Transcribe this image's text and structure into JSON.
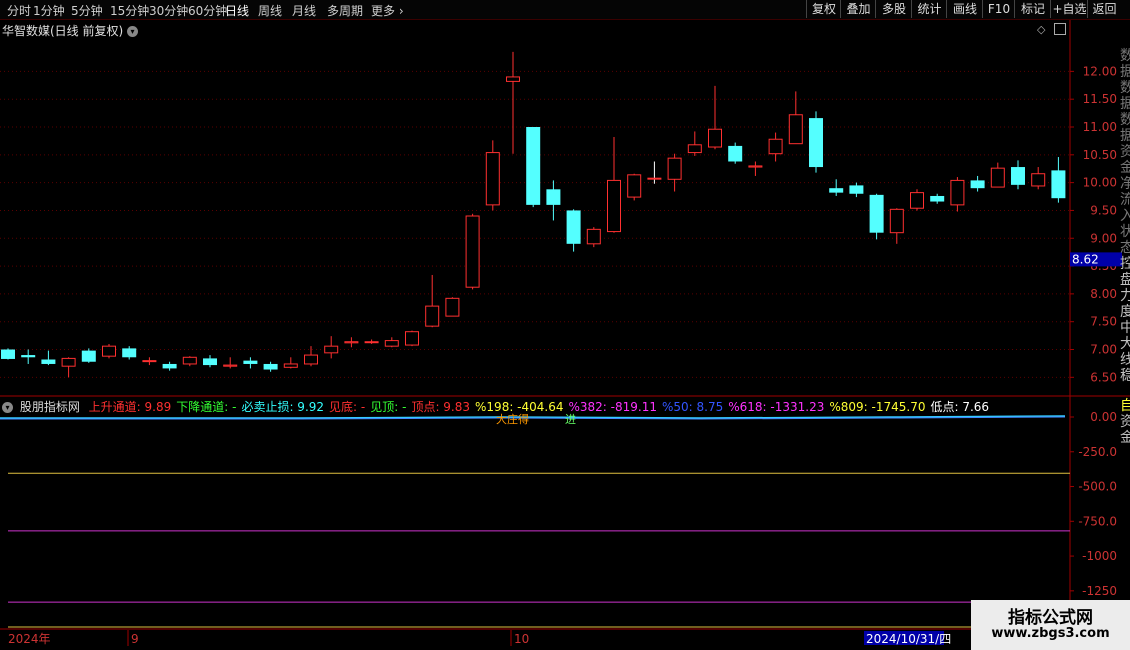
{
  "toolbar": {
    "periods": [
      "分时",
      "1分钟",
      "5分钟",
      "15分钟",
      "30分钟",
      "60分钟",
      "日线",
      "周线",
      "月线",
      "多周期",
      "更多"
    ],
    "active_period": "日线",
    "right_buttons": [
      "复权",
      "叠加",
      "多股",
      "统计",
      "画线",
      "F10",
      "标记",
      "+自选",
      "返回"
    ]
  },
  "chart_title": "华智数媒(日线 前复权)",
  "price_axis": [
    "12.00",
    "11.50",
    "11.00",
    "10.50",
    "10.00",
    "9.50",
    "9.00",
    "8.50",
    "8.00",
    "7.50",
    "7.00",
    "6.50"
  ],
  "current_price_tag": "8.62",
  "indicator": {
    "name": "股朋指标网",
    "items": [
      {
        "label": "上升通道: 9.89",
        "color": "#ff3030"
      },
      {
        "label": "下降通道: -",
        "color": "#33ff33"
      },
      {
        "label": "必卖止损: 9.92",
        "color": "#33ffff"
      },
      {
        "label": "见底: -",
        "color": "#ff3030"
      },
      {
        "label": "见顶: -",
        "color": "#33ff33"
      },
      {
        "label": "顶点: 9.83",
        "color": "#ff3030"
      },
      {
        "label": "%198: -404.64",
        "color": "#ffff33"
      },
      {
        "label": "%382: -819.11",
        "color": "#ff33ff"
      },
      {
        "label": "%50: 8.75",
        "color": "#3355ff"
      },
      {
        "label": "%618: -1331.23",
        "color": "#ff33ff"
      },
      {
        "label": "%809: -1745.70",
        "color": "#ffff33"
      },
      {
        "label": "低点: 7.66",
        "color": "#ffffff"
      }
    ],
    "annotations": [
      "大庄得",
      "进"
    ]
  },
  "indicator_axis": [
    "0.00",
    "-250.0",
    "-500.0",
    "-750.0",
    "-1000",
    "-1250"
  ],
  "date_axis": {
    "year_label": "2024年",
    "month_9": "9",
    "month_10": "10",
    "cursor_date": "2024/10/31/四"
  },
  "right_panel_chars": [
    "数",
    "据",
    "数",
    "据",
    "数",
    "据",
    "资",
    "金",
    "净",
    "流",
    "入",
    "状",
    "态",
    "控",
    "盘",
    "力",
    "度",
    "中",
    "大",
    "线",
    "稳"
  ],
  "right_panel_chars_lower": [
    "自",
    "资",
    "金"
  ],
  "watermark": {
    "line1": "指标公式网",
    "line2": "www.zbgs3.com"
  },
  "chart_data": {
    "type": "candlestick",
    "y_range": [
      6.2,
      12.6
    ],
    "up_color": "#ff3030",
    "down_color": "#54ffff",
    "candles": [
      [
        7.0,
        6.83,
        7.02,
        6.82
      ],
      [
        6.9,
        6.86,
        7.0,
        6.74
      ],
      [
        6.82,
        6.74,
        6.98,
        6.72
      ],
      [
        6.7,
        6.84,
        6.86,
        6.5
      ],
      [
        6.98,
        6.78,
        7.02,
        6.76
      ],
      [
        6.88,
        7.06,
        7.1,
        6.84
      ],
      [
        7.02,
        6.86,
        7.06,
        6.82
      ],
      [
        6.8,
        6.8,
        6.86,
        6.72
      ],
      [
        6.74,
        6.66,
        6.78,
        6.62
      ],
      [
        6.74,
        6.86,
        6.88,
        6.7
      ],
      [
        6.84,
        6.72,
        6.9,
        6.68
      ],
      [
        6.7,
        6.72,
        6.86,
        6.66
      ],
      [
        6.8,
        6.74,
        6.86,
        6.66
      ],
      [
        6.74,
        6.64,
        6.78,
        6.6
      ],
      [
        6.68,
        6.74,
        6.86,
        6.66
      ],
      [
        6.74,
        6.9,
        7.06,
        6.7
      ],
      [
        6.94,
        7.06,
        7.24,
        6.84
      ],
      [
        7.12,
        7.14,
        7.22,
        7.04
      ],
      [
        7.14,
        7.14,
        7.18,
        7.1
      ],
      [
        7.06,
        7.16,
        7.22,
        7.04
      ],
      [
        7.08,
        7.32,
        7.34,
        7.06
      ],
      [
        7.42,
        7.78,
        8.34,
        7.4
      ],
      [
        7.6,
        7.92,
        7.94,
        7.6
      ],
      [
        8.12,
        9.4,
        9.44,
        8.08
      ],
      [
        9.6,
        10.54,
        10.76,
        9.5
      ],
      [
        11.82,
        11.9,
        12.35,
        10.52
      ],
      [
        11.0,
        9.6,
        11.0,
        9.56
      ],
      [
        9.88,
        9.6,
        10.04,
        9.32
      ],
      [
        9.5,
        8.9,
        9.52,
        8.76
      ],
      [
        8.9,
        9.16,
        9.2,
        8.84
      ],
      [
        9.12,
        10.04,
        10.82,
        9.1
      ],
      [
        9.74,
        10.14,
        10.16,
        9.68
      ],
      [
        10.08,
        10.08,
        10.38,
        9.98
      ],
      [
        10.06,
        10.44,
        10.52,
        9.84
      ],
      [
        10.54,
        10.68,
        10.92,
        10.48
      ],
      [
        10.64,
        10.96,
        11.74,
        10.6
      ],
      [
        10.66,
        10.38,
        10.72,
        10.34
      ],
      [
        10.28,
        10.3,
        10.38,
        10.12
      ],
      [
        10.52,
        10.78,
        10.9,
        10.38
      ],
      [
        10.7,
        11.22,
        11.64,
        10.7
      ],
      [
        11.16,
        10.28,
        11.28,
        10.18
      ],
      [
        9.9,
        9.82,
        10.06,
        9.76
      ],
      [
        9.95,
        9.8,
        10.0,
        9.74
      ],
      [
        9.78,
        9.1,
        9.8,
        8.98
      ],
      [
        9.1,
        9.52,
        9.54,
        8.9
      ],
      [
        9.54,
        9.82,
        9.88,
        9.5
      ],
      [
        9.76,
        9.66,
        9.8,
        9.62
      ],
      [
        9.6,
        10.04,
        10.1,
        9.48
      ],
      [
        10.04,
        9.9,
        10.12,
        9.84
      ],
      [
        9.92,
        10.26,
        10.36,
        9.92
      ],
      [
        10.28,
        9.96,
        10.4,
        9.88
      ],
      [
        9.94,
        10.16,
        10.28,
        9.88
      ],
      [
        10.22,
        9.72,
        10.46,
        9.64
      ]
    ]
  }
}
